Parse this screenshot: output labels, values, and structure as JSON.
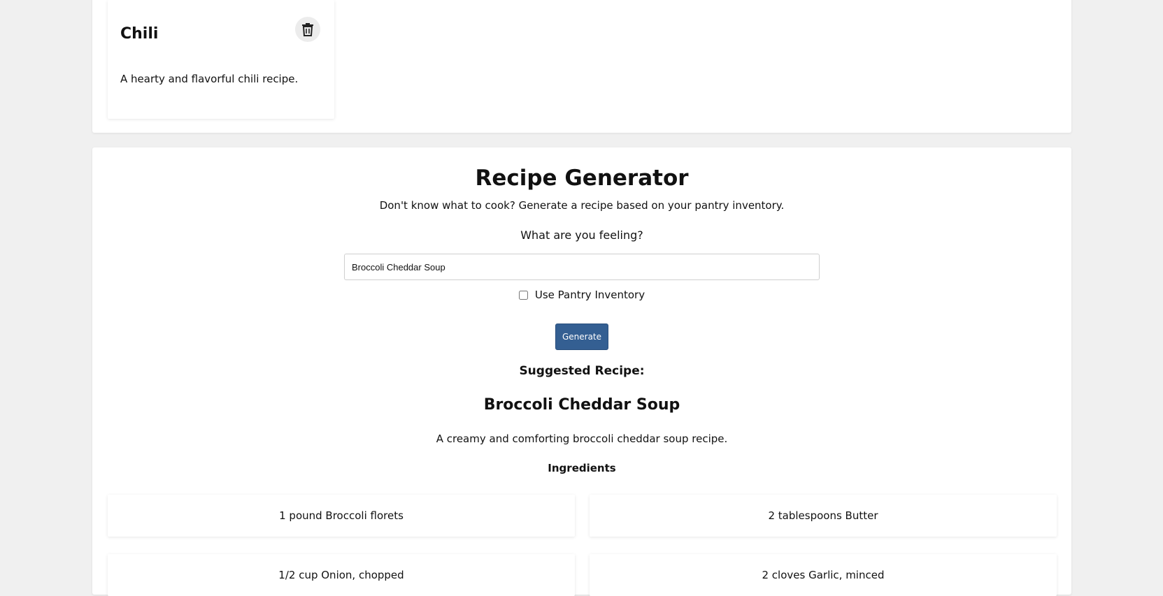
{
  "saved_recipe": {
    "title": "Chili",
    "description": "A hearty and flavorful chili recipe.",
    "delete_icon": "trash-icon"
  },
  "generator": {
    "title": "Recipe Generator",
    "subtitle": "Don't know what to cook? Generate a recipe based on your pantry inventory.",
    "prompt_label": "What are you feeling?",
    "input_value": "Broccoli Cheddar Soup",
    "checkbox_label": "Use Pantry Inventory",
    "checkbox_checked": false,
    "button_label": "Generate",
    "button_color": "#345f92"
  },
  "suggestion": {
    "heading": "Suggested Recipe:",
    "title": "Broccoli Cheddar Soup",
    "description": "A creamy and comforting broccoli cheddar soup recipe.",
    "ingredients_heading": "Ingredients",
    "ingredients": [
      "1 pound Broccoli florets",
      "2 tablespoons Butter",
      "1/2 cup Onion, chopped",
      "2 cloves Garlic, minced"
    ]
  }
}
